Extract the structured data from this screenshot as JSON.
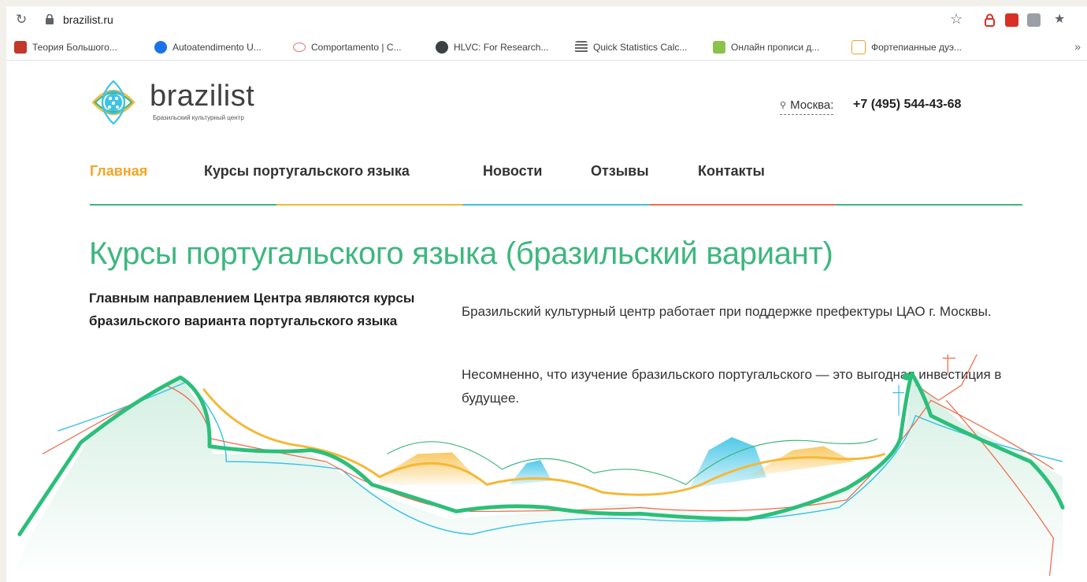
{
  "browser": {
    "url": "brazilist.ru",
    "more_bookmarks": "»",
    "bookmarks": [
      {
        "label": "Теория Большого...",
        "icon": "red-pixel-icon"
      },
      {
        "label": "Autoatendimento U...",
        "icon": "blue-globe-icon"
      },
      {
        "label": "Comportamento | C...",
        "icon": "pink-eye-icon"
      },
      {
        "label": "HLVC: For Research...",
        "icon": "dark-globe-icon"
      },
      {
        "label": "Quick Statistics Calc...",
        "icon": "calculator-icon"
      },
      {
        "label": "Онлайн прописи д...",
        "icon": "green-tile-icon"
      },
      {
        "label": "Фортепианные дуэ...",
        "icon": "music-note-icon"
      }
    ]
  },
  "site": {
    "brand": "brazilist",
    "tagline": "Бразильский культурный центр",
    "city": "Москва:",
    "phone": "+7 (495) 544-43-68",
    "nav": [
      {
        "label": "Главная",
        "active": true
      },
      {
        "label": "Курсы португальского языка",
        "active": false
      },
      {
        "label": "Новости",
        "active": false
      },
      {
        "label": "Отзывы",
        "active": false
      },
      {
        "label": "Контакты",
        "active": false
      }
    ],
    "title": "Курсы португальского языка (бразильский вариант)",
    "lead": "Главным направлением Центра являются курсы бразильского варианта португальского языка",
    "paragraph1": "Бразильский культурный центр работает при поддержке префектуры ЦАО г. Москвы.",
    "paragraph2": "Несомненно, что изучение бразильского португальского — это выгодная инвестиция в будущее."
  },
  "colors": {
    "accent_green": "#3db77f",
    "nav_active": "#f5a623",
    "line_yellow": "#f7b733",
    "line_blue": "#3cc3e6",
    "line_red": "#f26a4b"
  }
}
